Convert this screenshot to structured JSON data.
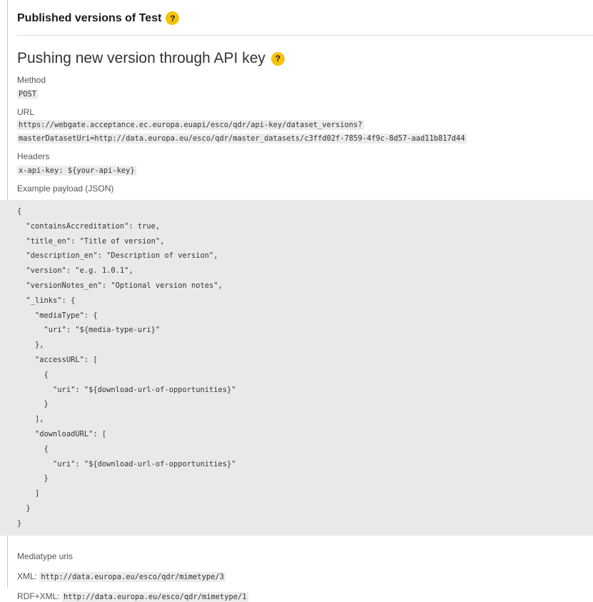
{
  "section": {
    "title": "Published versions of Test",
    "help": "?"
  },
  "api": {
    "title": "Pushing new version through API key",
    "help": "?",
    "method_label": "Method",
    "method": "POST",
    "url_label": "URL",
    "url_line1": "https://webgate.acceptance.ec.europa.euapi/esco/qdr/api-key/dataset_versions?",
    "url_line2": "masterDatasetUri=http://data.europa.eu/esco/qdr/master_datasets/c3ffd02f-7859-4f9c-8d57-aad11b817d44",
    "headers_label": "Headers",
    "header": "x-api-key: ${your-api-key}",
    "payload_label": "Example payload (JSON)",
    "payload": "{\n  \"containsAccreditation\": true,\n  \"title_en\": \"Title of version\",\n  \"description_en\": \"Description of version\",\n  \"version\": \"e.g. 1.0.1\",\n  \"versionNotes_en\": \"Optional version notes\",\n  \"_links\": {\n    \"mediaType\": {\n      \"uri\": \"${media-type-uri}\"\n    },\n    \"accessURL\": [\n      {\n        \"uri\": \"${download-url-of-opportunities}\"\n      }\n    ],\n    \"downloadURL\": [\n      {\n        \"uri\": \"${download-url-of-opportunities}\"\n      }\n    ]\n  }\n}"
  },
  "mediatypes": {
    "label": "Mediatype uris",
    "xml_label": "XML:",
    "xml_uri": "http://data.europa.eu/esco/qdr/mimetype/3",
    "rdf_label": "RDF+XML:",
    "rdf_uri": "http://data.europa.eu/esco/qdr/mimetype/1"
  },
  "colors": {
    "help_badge": "#f5c20b",
    "code_bg": "#e9e9e9"
  }
}
